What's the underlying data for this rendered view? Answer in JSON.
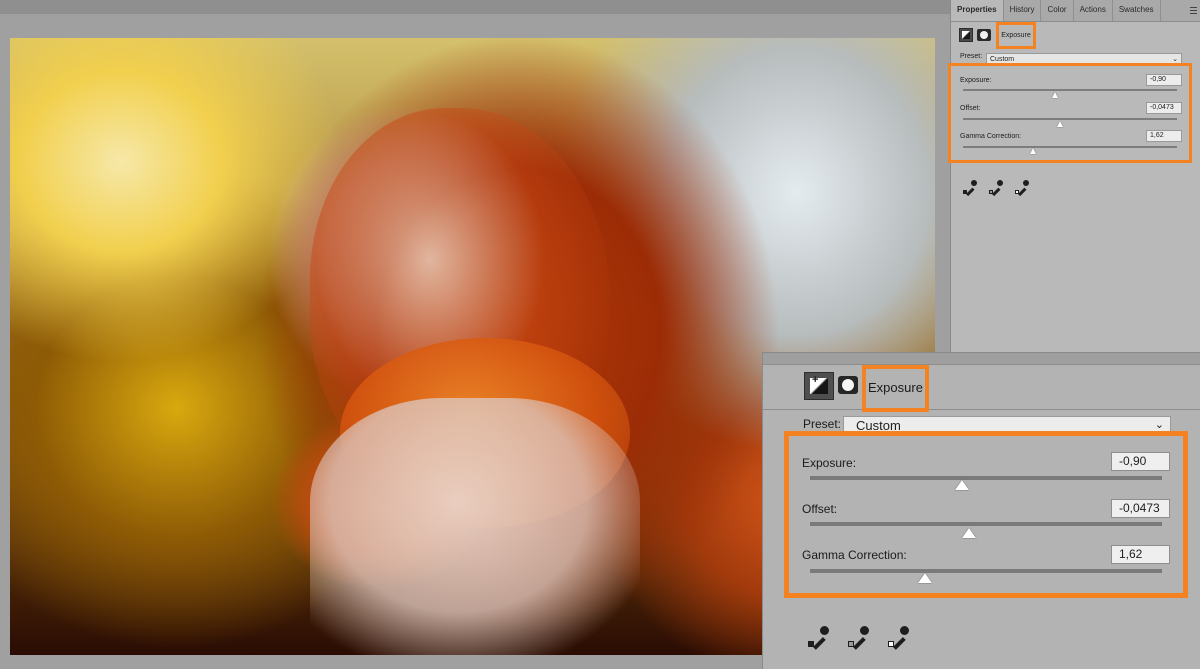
{
  "app": {
    "tabs": [
      "Properties",
      "History",
      "Color",
      "Actions",
      "Swatches"
    ],
    "active_tab": "Properties"
  },
  "panel": {
    "title": "Exposure",
    "preset_label": "Preset:",
    "preset_value": "Custom",
    "sliders": [
      {
        "label": "Exposure:",
        "value": "-0,90",
        "position": 0.44
      },
      {
        "label": "Offset:",
        "value": "-0,0473",
        "position": 0.46
      },
      {
        "label": "Gamma Correction:",
        "value": "1,62",
        "position": 0.33
      }
    ],
    "eyedroppers": [
      "black-eyedropper-icon",
      "gray-eyedropper-icon",
      "white-eyedropper-icon"
    ]
  },
  "colors": {
    "highlight": "#f58220",
    "panel_bg": "#b9b9b9"
  }
}
